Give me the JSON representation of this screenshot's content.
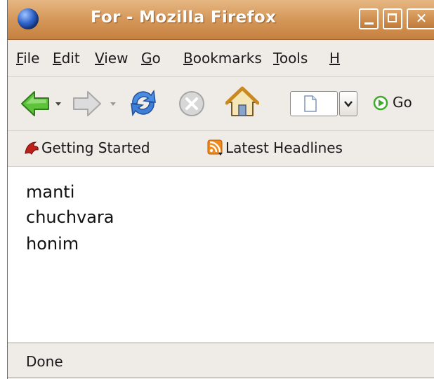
{
  "window": {
    "title": "For - Mozilla Firefox",
    "buttons": {
      "minimize": "minimize",
      "maximize": "maximize",
      "close": "close"
    }
  },
  "menubar": {
    "items": [
      {
        "mnemonic": "F",
        "rest": "ile"
      },
      {
        "mnemonic": "E",
        "rest": "dit"
      },
      {
        "mnemonic": "V",
        "rest": "iew"
      },
      {
        "mnemonic": "G",
        "rest": "o"
      },
      {
        "mnemonic": "B",
        "rest": "ookmarks"
      },
      {
        "mnemonic": "T",
        "rest": "ools"
      },
      {
        "mnemonic": "H",
        "rest": ""
      }
    ]
  },
  "navbar": {
    "icons": [
      "back-icon",
      "forward-icon",
      "reload-icon",
      "stop-icon",
      "home-icon"
    ],
    "go_label": "Go"
  },
  "bookmarks": {
    "items": [
      {
        "icon": "firefox-bookmark-icon",
        "label": "Getting Started"
      },
      {
        "icon": "rss-feed-icon",
        "label": "Latest Headlines"
      }
    ]
  },
  "content": {
    "lines": [
      "manti",
      "chuchvara",
      "honim"
    ]
  },
  "status": {
    "text": "Done"
  },
  "colors": {
    "titlebar": "#d69a5c",
    "chrome": "#efebe7",
    "back_arrow": "#46b42a",
    "reload": "#3f7fd6"
  }
}
